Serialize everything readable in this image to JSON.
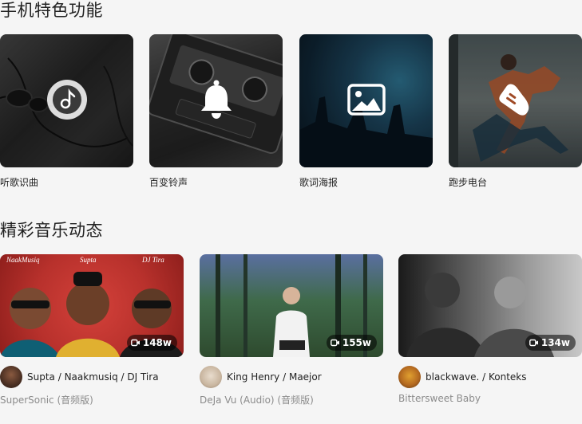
{
  "features_section": {
    "title": "手机特色功能",
    "items": [
      {
        "label": "听歌识曲",
        "icon": "music-note-icon"
      },
      {
        "label": "百变铃声",
        "icon": "bell-icon"
      },
      {
        "label": "歌词海报",
        "icon": "image-icon"
      },
      {
        "label": "跑步电台",
        "icon": "shoe-icon"
      }
    ]
  },
  "videos_section": {
    "title": "精彩音乐动态",
    "items": [
      {
        "views": "148w",
        "artists": "Supta / Naakmusiq / DJ Tira",
        "title": "SuperSonic (音频版)",
        "thumb_text": [
          "NaakMusiq",
          "Supta",
          "DJ Tira"
        ]
      },
      {
        "views": "155w",
        "artists": "King Henry / Maejor",
        "title": "DeJa Vu (Audio) (音频版)"
      },
      {
        "views": "134w",
        "artists": "blackwave. / Konteks",
        "title": "Bittersweet Baby"
      }
    ]
  },
  "colors": {
    "background": "#f5f5f5",
    "muted_text": "#8c8c8c"
  }
}
